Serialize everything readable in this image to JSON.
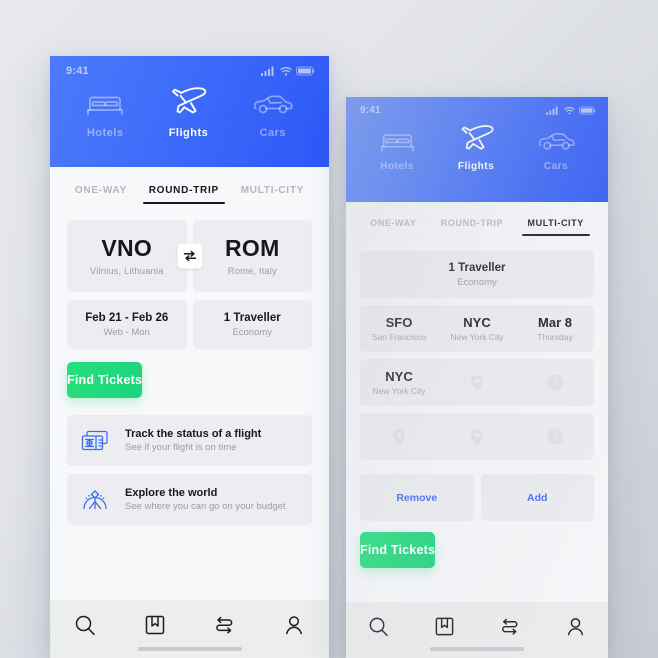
{
  "phone_left": {
    "status_bar": {
      "time": "9:41",
      "icons": [
        "signal-icon",
        "wifi-icon",
        "battery-icon"
      ]
    },
    "modes": [
      {
        "label": "Hotels",
        "icon": "bed-icon",
        "active": false
      },
      {
        "label": "Flights",
        "icon": "airplane-icon",
        "active": true
      },
      {
        "label": "Cars",
        "icon": "car-icon",
        "active": false
      }
    ],
    "trip_tabs": [
      {
        "label": "ONE-WAY",
        "active": false
      },
      {
        "label": "ROUND-TRIP",
        "active": true
      },
      {
        "label": "MULTI-CITY",
        "active": false
      }
    ],
    "origin": {
      "code": "VNO",
      "city": "Vilnius, Lithuania"
    },
    "destination": {
      "code": "ROM",
      "city": "Rome, Italy"
    },
    "swap_icon": "swap-arrows-icon",
    "dates": {
      "value": "Feb 21 - Feb 26",
      "days": "Web - Mon"
    },
    "travellers": {
      "value": "1 Traveller",
      "class": "Economy"
    },
    "find_button": "Find Tickets",
    "promos": [
      {
        "icon": "boarding-pass-icon",
        "title": "Track the status of a flight",
        "subtitle": "See if your flight is on time"
      },
      {
        "icon": "globe-compass-icon",
        "title": "Explore the world",
        "subtitle": "See where you can go on your budget"
      }
    ],
    "bottom_nav": [
      {
        "icon": "search-icon"
      },
      {
        "icon": "bookmark-book-icon"
      },
      {
        "icon": "transfer-arrows-icon"
      },
      {
        "icon": "person-icon"
      }
    ]
  },
  "phone_right": {
    "status_bar": {
      "time": "9:41",
      "icons": [
        "signal-icon",
        "wifi-icon",
        "battery-icon"
      ]
    },
    "modes": [
      {
        "label": "Hotels",
        "icon": "bed-icon",
        "active": false
      },
      {
        "label": "Flights",
        "icon": "airplane-icon",
        "active": true
      },
      {
        "label": "Cars",
        "icon": "car-icon",
        "active": false
      }
    ],
    "trip_tabs": [
      {
        "label": "ONE-WAY",
        "active": false
      },
      {
        "label": "ROUND-TRIP",
        "active": false
      },
      {
        "label": "MULTI-CITY",
        "active": true
      }
    ],
    "travellers": {
      "value": "1 Traveller",
      "class": "Economy"
    },
    "legs": [
      {
        "from_code": "SFO",
        "from_city": "San Francisco",
        "to_code": "NYC",
        "to_city": "New York City",
        "date": "Mar 8",
        "day": "Thursday"
      },
      {
        "from_code": "NYC",
        "from_city": "New York City",
        "to_placeholder": "map-pin-icon",
        "date_placeholder": "clock-icon"
      },
      {
        "from_placeholder": "map-pin-icon",
        "to_placeholder": "map-pin-icon",
        "date_placeholder": "clock-icon"
      }
    ],
    "remove_button": "Remove",
    "add_button": "Add",
    "find_button": "Find Tickets",
    "bottom_nav": [
      {
        "icon": "search-icon"
      },
      {
        "icon": "bookmark-book-icon"
      },
      {
        "icon": "transfer-arrows-icon"
      },
      {
        "icon": "person-icon"
      }
    ]
  },
  "colors": {
    "header_blue_light": "#4b7bfb",
    "header_blue_dark": "#2d58f7",
    "accent_green": "#22d97c",
    "link_blue": "#3d6cfa",
    "card_gray": "#ededf1"
  }
}
